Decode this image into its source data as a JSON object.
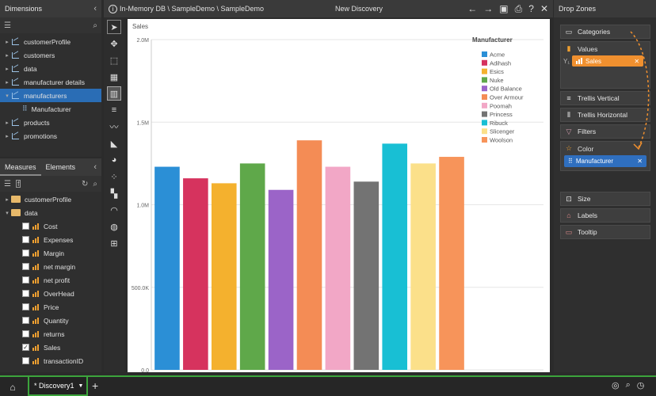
{
  "dimensions": {
    "title": "Dimensions",
    "items": [
      {
        "label": "customerProfile",
        "type": "hier",
        "level": 0,
        "tri": "▸"
      },
      {
        "label": "customers",
        "type": "hier",
        "level": 0,
        "tri": "▸"
      },
      {
        "label": "data",
        "type": "hier",
        "level": 0,
        "tri": "▸"
      },
      {
        "label": "manufacturer details",
        "type": "hier",
        "level": 0,
        "tri": "▸"
      },
      {
        "label": "manufacturers",
        "type": "hier",
        "level": 0,
        "tri": "▾",
        "selected": true
      },
      {
        "label": "Manufacturer",
        "type": "attr",
        "level": 1,
        "tri": ""
      },
      {
        "label": "products",
        "type": "hier",
        "level": 0,
        "tri": "▸"
      },
      {
        "label": "promotions",
        "type": "hier",
        "level": 0,
        "tri": "▸"
      }
    ]
  },
  "measures": {
    "tab_measures": "Measures",
    "tab_elements": "Elements",
    "items": [
      {
        "label": "customerProfile",
        "type": "folder",
        "tri": "▸"
      },
      {
        "label": "data",
        "type": "folder",
        "tri": "▾"
      },
      {
        "label": "Cost",
        "type": "measure",
        "checked": false
      },
      {
        "label": "Expenses",
        "type": "measure",
        "checked": false
      },
      {
        "label": "Margin",
        "type": "measure",
        "checked": false
      },
      {
        "label": "net margin",
        "type": "measure",
        "checked": false
      },
      {
        "label": "net profit",
        "type": "measure",
        "checked": false
      },
      {
        "label": "OverHead",
        "type": "measure",
        "checked": false
      },
      {
        "label": "Price",
        "type": "measure",
        "checked": false
      },
      {
        "label": "Quantity",
        "type": "measure",
        "checked": false
      },
      {
        "label": "returns",
        "type": "measure",
        "checked": false
      },
      {
        "label": "Sales",
        "type": "measure",
        "checked": true
      },
      {
        "label": "transactionID",
        "type": "measure",
        "checked": false
      }
    ]
  },
  "header": {
    "info_icon": "ⓘ",
    "breadcrumb": "In-Memory DB \\ SampleDemo \\ SampleDemo",
    "title": "New Discovery"
  },
  "chart_data": {
    "type": "bar",
    "title": "Sales",
    "legend_title": "Manufacturer",
    "ylim": [
      0,
      2000000
    ],
    "yticks": [
      {
        "value": 0,
        "label": "0.0"
      },
      {
        "value": 500000,
        "label": "500.0K"
      },
      {
        "value": 1000000,
        "label": "1.0M"
      },
      {
        "value": 1500000,
        "label": "1.5M"
      },
      {
        "value": 2000000,
        "label": "2.0M"
      }
    ],
    "categories": [
      "Acme",
      "Adihash",
      "Esics",
      "Nuke",
      "Old Balance",
      "Over Armour",
      "Poomah",
      "Princess",
      "Ribuck",
      "Slicenger",
      "Woolson"
    ],
    "values": [
      1230000,
      1160000,
      1130000,
      1250000,
      1090000,
      1390000,
      1230000,
      1140000,
      1370000,
      1250000,
      1290000
    ],
    "colors": [
      "#2b8fd6",
      "#d6335e",
      "#f4b12e",
      "#5fa84a",
      "#9b64c8",
      "#f48c55",
      "#f2a7c6",
      "#737373",
      "#18bfd4",
      "#fbe08a",
      "#f7945a"
    ]
  },
  "dropzones": {
    "title": "Drop Zones",
    "categories": "Categories",
    "values": "Values",
    "y1": "Y₁",
    "sales_pill": "Sales",
    "trellis_v": "Trellis Vertical",
    "trellis_h": "Trellis Horizontal",
    "filters": "Filters",
    "color": "Color",
    "manufacturer_pill": "Manufacturer",
    "size": "Size",
    "labels": "Labels",
    "tooltip": "Tooltip"
  },
  "bottom": {
    "tab_label": "* Discovery1",
    "add": "+"
  }
}
